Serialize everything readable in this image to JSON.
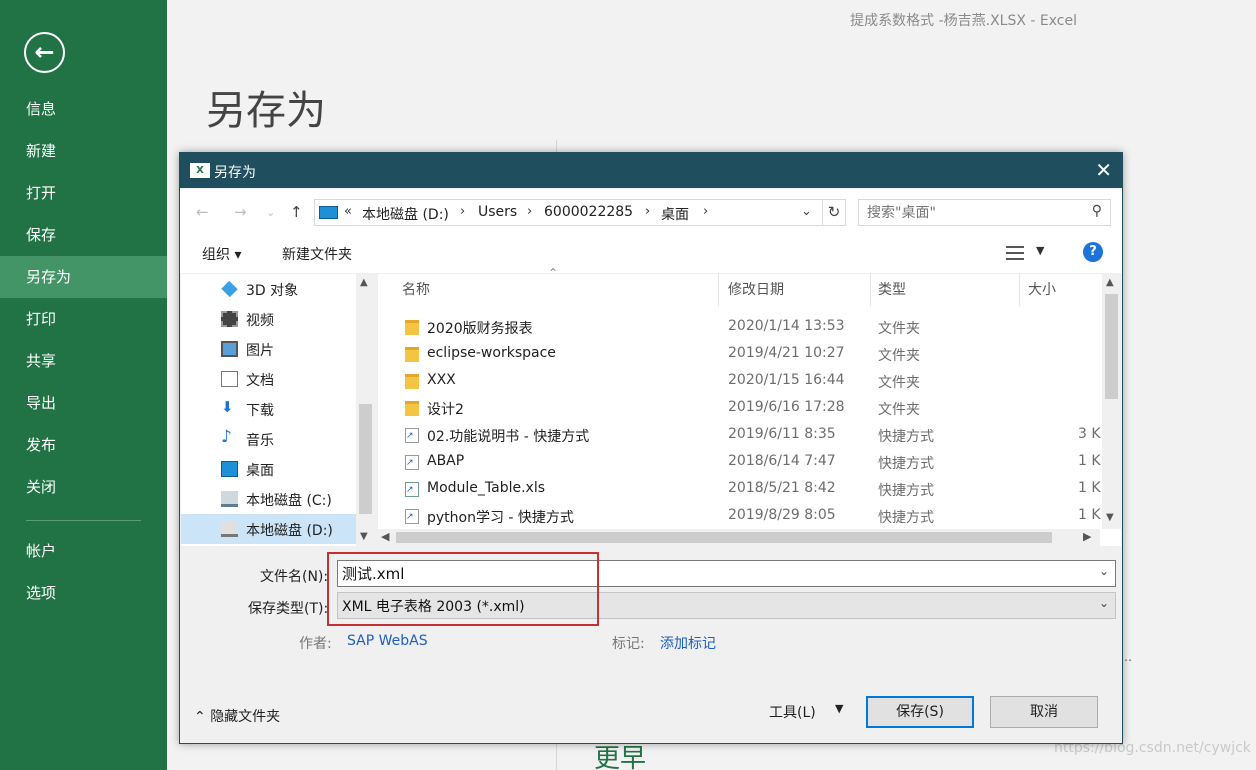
{
  "window_title": "提成系数格式 -杨吉燕.XLSX - Excel",
  "backstage": {
    "back_icon": "back-arrow-icon",
    "heading": "另存为",
    "nav": [
      "信息",
      "新建",
      "打开",
      "保存",
      "另存为",
      "打印",
      "共享",
      "导出",
      "发布",
      "关闭",
      "帐户",
      "选项"
    ],
    "active_item": "另存为",
    "bottom_text": "更早",
    "watermark": "https://blog.csdn.net/cywjck"
  },
  "dialog": {
    "title": "另存为",
    "address": {
      "overflow": "«",
      "crumbs": [
        "本地磁盘 (D:)",
        "Users",
        "6000022285",
        "桌面"
      ]
    },
    "search_placeholder": "搜索\"桌面\"",
    "toolbar": {
      "organize": "组织 ▾",
      "new_folder": "新建文件夹"
    },
    "tree": [
      {
        "label": "3D 对象",
        "icon": "3d-objects-icon"
      },
      {
        "label": "视频",
        "icon": "video-icon"
      },
      {
        "label": "图片",
        "icon": "pictures-icon"
      },
      {
        "label": "文档",
        "icon": "documents-icon"
      },
      {
        "label": "下载",
        "icon": "download-icon"
      },
      {
        "label": "音乐",
        "icon": "music-icon"
      },
      {
        "label": "桌面",
        "icon": "desktop-icon"
      },
      {
        "label": "本地磁盘 (C:)",
        "icon": "drive-c-icon"
      },
      {
        "label": "本地磁盘 (D:)",
        "icon": "drive-d-icon",
        "selected": true
      }
    ],
    "columns": [
      "名称",
      "修改日期",
      "类型",
      "大小"
    ],
    "files": [
      {
        "name": "2020版财务报表",
        "date": "2020/1/14 13:53",
        "type": "文件夹",
        "size": "",
        "icon": "folder-icon"
      },
      {
        "name": "eclipse-workspace",
        "date": "2019/4/21 10:27",
        "type": "文件夹",
        "size": "",
        "icon": "folder-icon"
      },
      {
        "name": "XXX",
        "date": "2020/1/15 16:44",
        "type": "文件夹",
        "size": "",
        "icon": "folder-icon"
      },
      {
        "name": "设计2",
        "date": "2019/6/16 17:28",
        "type": "文件夹",
        "size": "",
        "icon": "folder-icon"
      },
      {
        "name": "02.功能说明书 - 快捷方式",
        "date": "2019/6/11 8:35",
        "type": "快捷方式",
        "size": "3 K",
        "icon": "shortcut-icon"
      },
      {
        "name": "ABAP",
        "date": "2018/6/14 7:47",
        "type": "快捷方式",
        "size": "1 K",
        "icon": "shortcut-icon"
      },
      {
        "name": "Module_Table.xls",
        "date": "2018/5/21 8:42",
        "type": "快捷方式",
        "size": "1 K",
        "icon": "xls-shortcut-icon"
      },
      {
        "name": "python学习 - 快捷方式",
        "date": "2019/8/29 8:05",
        "type": "快捷方式",
        "size": "1 K",
        "icon": "shortcut-icon"
      }
    ],
    "filename_label": "文件名(N):",
    "filename_value": "测试.xml",
    "filetype_label": "保存类型(T):",
    "filetype_value": "XML 电子表格 2003 (*.xml)",
    "author_label": "作者:",
    "author_value": "SAP WebAS",
    "tags_label": "标记:",
    "tags_value": "添加标记",
    "hide_folders": "隐藏文件夹",
    "tools": "工具(L)",
    "save": "保存(S)",
    "cancel": "取消"
  }
}
